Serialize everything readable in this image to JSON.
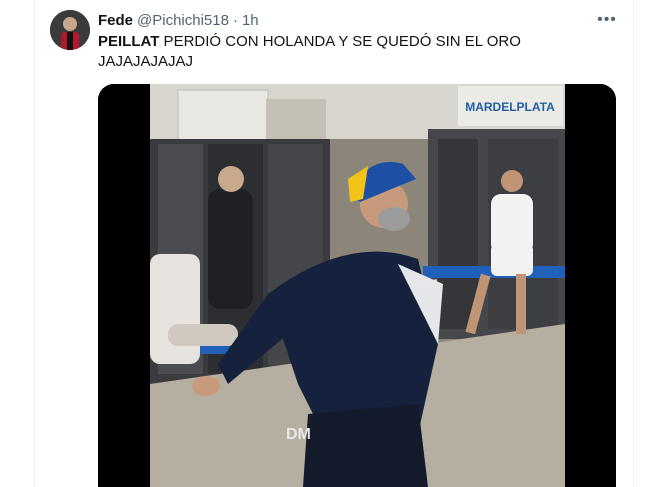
{
  "tweet": {
    "display_name": "Fede",
    "handle": "@Pichichi518",
    "separator": "·",
    "time": "1h",
    "text_bold": "PEILLAT",
    "text_rest": " PERDIÓ CON HOLANDA Y SE QUEDÓ SIN EL ORO JAJAJAJAJAJ",
    "more_icon": "more-horizontal-icon"
  },
  "media": {
    "sign_text": "MARDELPLATA",
    "jacket_logo": "DM",
    "pants_logo": "DM"
  }
}
